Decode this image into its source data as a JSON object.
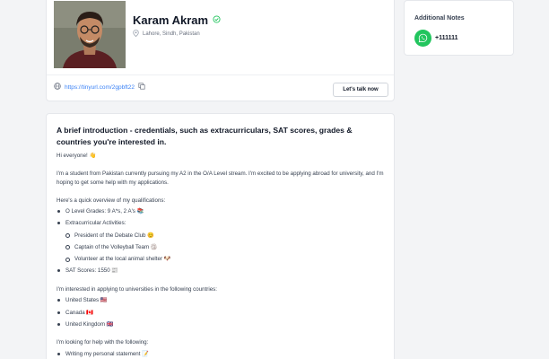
{
  "profile": {
    "name": "Karam Akram",
    "location": "Lahore, Sindh, Pakistan",
    "link": "https://tinyurl.com/2gpbft22",
    "talk_button": "Let's talk now",
    "verified_color": "#22c55e"
  },
  "notes": {
    "title": "Additional Notes",
    "whatsapp": "+111111",
    "icon": "whatsapp-icon"
  },
  "intro": {
    "title": "A brief introduction - credentials, such as extracurriculars, SAT scores, grades & countries you're interested in.",
    "greeting": "Hi everyone! 👋",
    "paragraph": "I'm a student from Pakistan currently pursuing my A2 in the O/A Level stream. I'm excited to be applying abroad for university, and I'm hoping to get some help with my applications.",
    "overview_heading": "Here's a quick overview of my qualifications:",
    "o_level": "O Level Grades: 9 A*s, 2 A's 📚",
    "extracurricular": "Extracurricular Activities:",
    "activities": [
      "President of the Debate Club 😊",
      "Captain of the Volleyball Team 🏐",
      "Volunteer at the local animal shelter 🐶"
    ],
    "sat": "SAT Scores: 1550 📰",
    "countries_heading": "I'm interested in applying to universities in the following countries:",
    "countries": [
      "United States 🇺🇸",
      "Canada 🇨🇦",
      "United Kingdom 🇬🇧"
    ],
    "help_heading": "I'm looking for help with the following:",
    "help_items": [
      "Writing my personal statement 📝"
    ]
  }
}
